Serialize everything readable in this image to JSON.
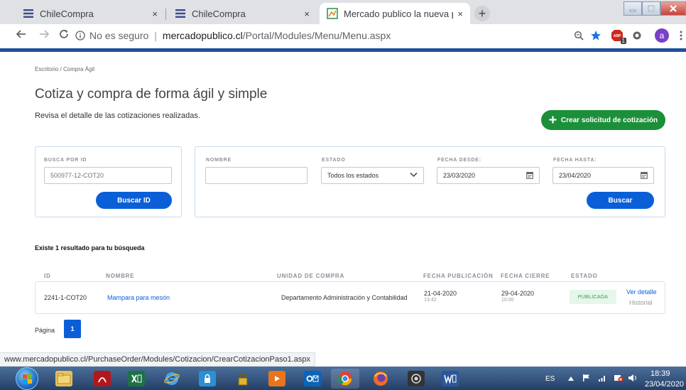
{
  "browser": {
    "tabs": [
      {
        "title": "ChileCompra",
        "close": "×"
      },
      {
        "title": "ChileCompra",
        "close": "×"
      },
      {
        "title": "Mercado publico la nueva platafo",
        "close": "×"
      }
    ],
    "new_tab": "+",
    "address": {
      "security": "No es seguro",
      "host": "mercadopublico.cl",
      "path": "/Portal/Modules/Menu/Menu.aspx"
    },
    "profile_initial": "a",
    "extension_badge": "1"
  },
  "page": {
    "breadcrumb": "Escritorio  /  Compra Ágil",
    "title": "Cotiza y compra de forma ágil y simple",
    "subtitle": "Revisa el detalle de las cotizaciones realizadas.",
    "create_button": "Crear solicitud de cotización",
    "search_id": {
      "label": "BUSCA POR ID",
      "placeholder": "500977-12-COT20",
      "button": "Buscar ID"
    },
    "filters": {
      "name_label": "NOMBRE",
      "name_value": "",
      "status_label": "ESTADO",
      "status_value": "Todos los estados",
      "from_label": "FECHA DESDE:",
      "from_value": "23/03/2020",
      "to_label": "FECHA HASTA:",
      "to_value": "23/04/2020",
      "button": "Buscar"
    },
    "results_count": "Existe 1 resultado para tu búsqueda",
    "table": {
      "headers": [
        "ID",
        "NOMBRE",
        "UNIDAD DE COMPRA",
        "FECHA PUBLICACIÓN",
        "FECHA CIERRE",
        "ESTADO"
      ],
      "rows": [
        {
          "id": "2241-1-COT20",
          "name": "Mampara para mesón",
          "unit": "Departamento Administración y Contabilidad",
          "pub_date": "21-04-2020",
          "pub_time": "13:42",
          "close_date": "29-04-2020",
          "close_time": "10:00",
          "status": "PUBLICADA",
          "detail_link": "Ver detalle",
          "history_link": "Historial"
        }
      ]
    },
    "pager": {
      "label": "Página",
      "current": "1"
    }
  },
  "status_url": "www.mercadopublico.cl/PurchaseOrder/Modules/Cotizacion/CrearCotizacionPaso1.aspx",
  "taskbar": {
    "lang": "ES",
    "time": "18:39",
    "date": "23/04/2020"
  }
}
